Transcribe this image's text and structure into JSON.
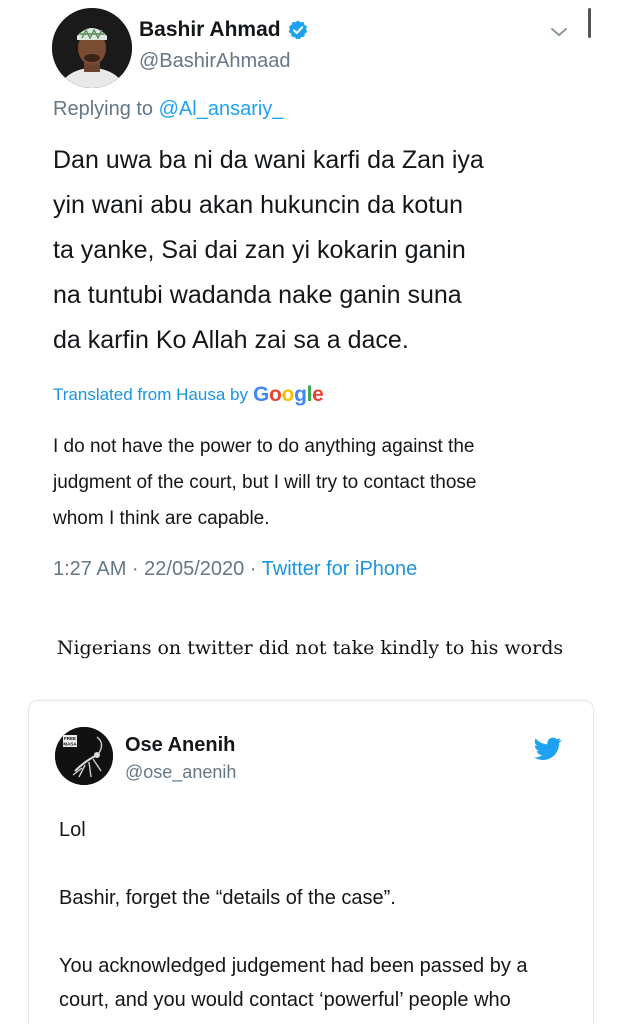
{
  "tweet": {
    "author_name": "Bashir Ahmad",
    "author_handle": "@BashirAhmaad",
    "replying_prefix": "Replying to",
    "replying_to": "@Al_ansariy_",
    "body_lines": [
      "Dan uwa ba ni da wani karfi da Zan iya",
      "yin wani abu akan hukuncin da kotun",
      "ta yanke, Sai dai zan yi kokarin ganin",
      "na tuntubi wadanda nake ganin suna",
      "da karfin Ko Allah zai sa a dace."
    ],
    "translated_label": "Translated from Hausa by",
    "translator": "Google",
    "translation_lines": [
      "I do not have the power to do anything against the",
      "judgment of the court, but I will try to contact those",
      "whom I think are capable."
    ],
    "timestamp": "1:27 AM · 22/05/2020 · ",
    "source": "Twitter for iPhone",
    "icons": {
      "verified": "verified-badge-icon",
      "menu": "chevron-down-icon"
    },
    "colors": {
      "link": "#1b95e0",
      "muted": "#657786",
      "text": "#14171a"
    }
  },
  "caption": "Nigerians on twitter did not take kindly to his words",
  "embedded_tweet": {
    "author_name": "Ose Anenih",
    "author_handle": "@ose_anenih",
    "avatar_text": "FREE MASA",
    "paragraphs": [
      "Lol",
      "Bashir, forget the “details of the case”.",
      "You acknowledged judgement had been passed by a court, and you would contact ‘powerful’ people who could do something"
    ],
    "icons": {
      "brand": "twitter-bird-icon"
    },
    "colors": {
      "brand": "#1da1f2"
    }
  }
}
